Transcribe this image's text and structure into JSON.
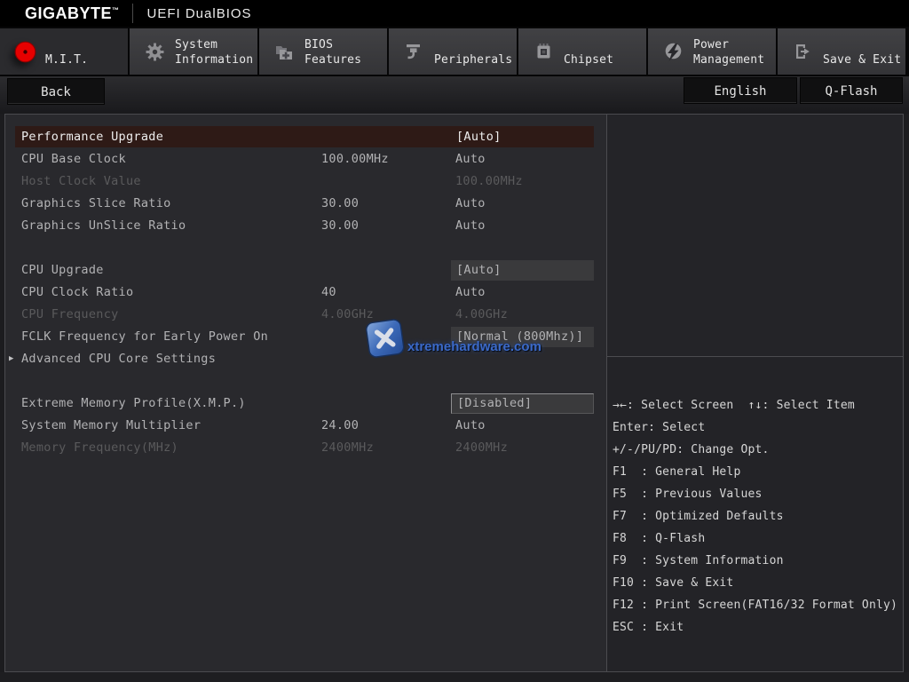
{
  "header": {
    "brand": "GIGABYTE",
    "trademark": "™",
    "firmware_title": "UEFI DualBIOS"
  },
  "tabs": [
    {
      "label": "M.I.T.",
      "icon": "red-disc-icon",
      "active": true
    },
    {
      "label": "System\nInformation",
      "icon": "gear-icon",
      "active": false
    },
    {
      "label": "BIOS\nFeatures",
      "icon": "folder-plus-icon",
      "active": false
    },
    {
      "label": "Peripherals",
      "icon": "peripheral-icon",
      "active": false
    },
    {
      "label": "Chipset",
      "icon": "chip-icon",
      "active": false
    },
    {
      "label": "Power\nManagement",
      "icon": "lightning-icon",
      "active": false
    },
    {
      "label": "Save & Exit",
      "icon": "exit-icon",
      "active": false
    }
  ],
  "toolbar": {
    "back_label": "Back",
    "english_label": "English",
    "qflash_label": "Q-Flash"
  },
  "settings": [
    {
      "label": "Performance Upgrade",
      "middle": "",
      "value": "[Auto]",
      "state": "selected",
      "value_box": "selbox"
    },
    {
      "label": "CPU Base Clock",
      "middle": "100.00MHz",
      "value": "Auto",
      "state": "normal",
      "value_box": "none"
    },
    {
      "label": "Host Clock Value",
      "middle": "",
      "value": "100.00MHz",
      "state": "disabled",
      "value_box": "none"
    },
    {
      "label": "Graphics Slice Ratio",
      "middle": "30.00",
      "value": "Auto",
      "state": "normal",
      "value_box": "none"
    },
    {
      "label": "Graphics UnSlice Ratio",
      "middle": "30.00",
      "value": "Auto",
      "state": "normal",
      "value_box": "none"
    },
    {
      "spacer": true
    },
    {
      "label": "CPU Upgrade",
      "middle": "",
      "value": "[Auto]",
      "state": "normal",
      "value_box": "plain"
    },
    {
      "label": "CPU Clock Ratio",
      "middle": "40",
      "value": "Auto",
      "state": "normal",
      "value_box": "none"
    },
    {
      "label": "CPU Frequency",
      "middle": "4.00GHz",
      "value": "4.00GHz",
      "state": "disabled",
      "value_box": "none"
    },
    {
      "label": "FCLK Frequency for Early Power On",
      "middle": "",
      "value": "[Normal (800Mhz)]",
      "state": "normal",
      "value_box": "plain"
    },
    {
      "label": "Advanced CPU Core Settings",
      "middle": "",
      "value": "",
      "state": "normal",
      "value_box": "none",
      "expandable": true
    },
    {
      "spacer": true
    },
    {
      "label": "Extreme Memory Profile(X.M.P.)",
      "middle": "",
      "value": "[Disabled]",
      "state": "normal",
      "value_box": "outlined"
    },
    {
      "label": "System Memory Multiplier",
      "middle": "24.00",
      "value": "Auto",
      "state": "normal",
      "value_box": "none"
    },
    {
      "label": "Memory Frequency(MHz)",
      "middle": "2400MHz",
      "value": "2400MHz",
      "state": "disabled",
      "value_box": "none"
    }
  ],
  "help_keys": [
    "→←: Select Screen  ↑↓: Select Item",
    "Enter: Select",
    "+/-/PU/PD: Change Opt.",
    "F1  : General Help",
    "F5  : Previous Values",
    "F7  : Optimized Defaults",
    "F8  : Q-Flash",
    "F9  : System Information",
    "F10 : Save & Exit",
    "F12 : Print Screen(FAT16/32 Format Only)",
    "ESC : Exit"
  ],
  "watermark": {
    "text": "xtremehardware.com"
  },
  "colors": {
    "accent_red": "#e60000",
    "selected_row_bg": "#2e1a16",
    "panel_bg": "#29292d",
    "value_box_bg": "#3a3a3c",
    "watermark_blue": "#3d6fd6"
  }
}
